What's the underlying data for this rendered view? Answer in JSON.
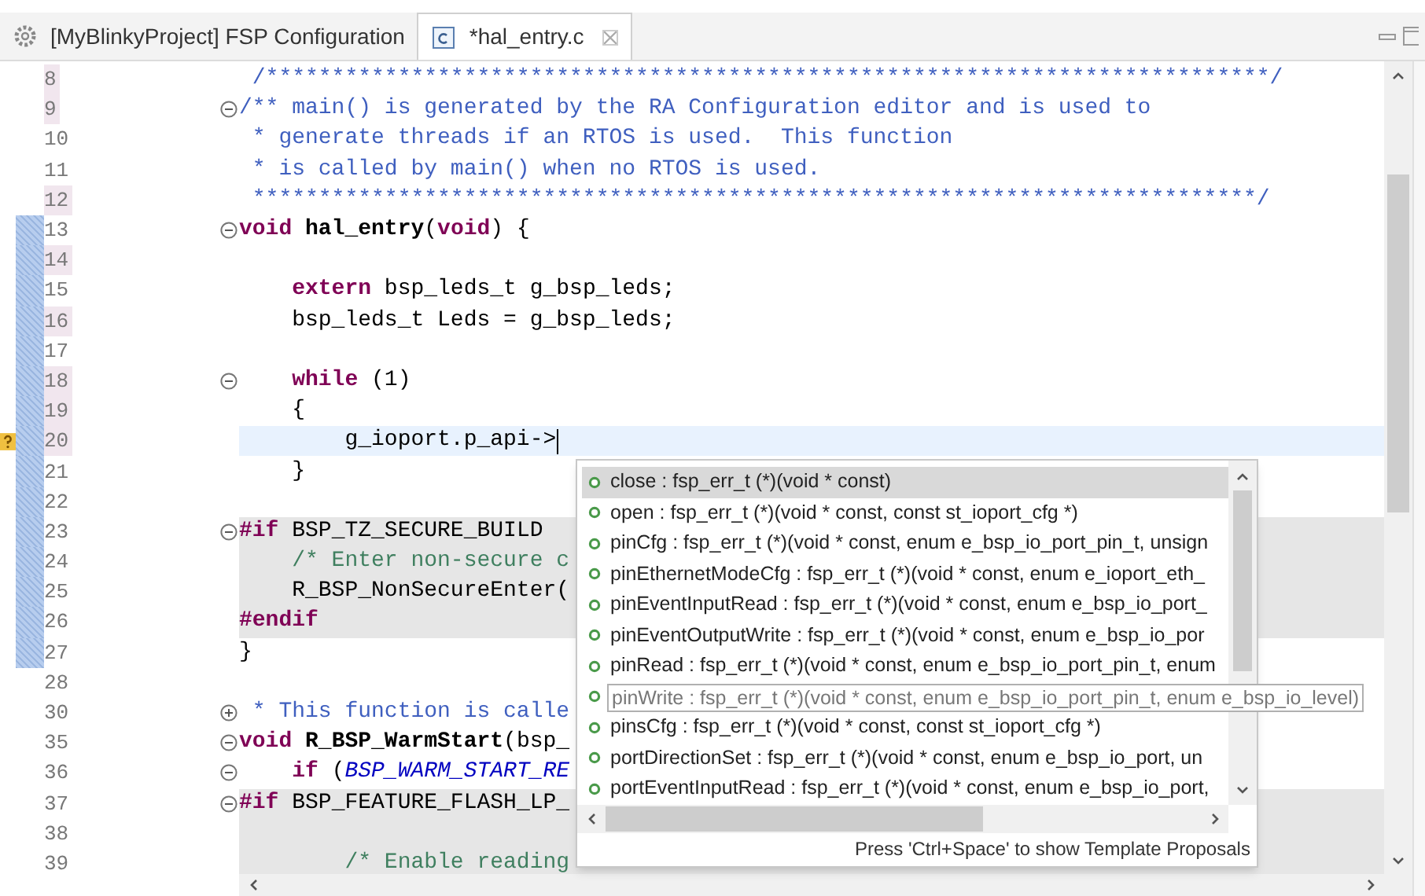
{
  "tabs": [
    {
      "label": "[MyBlinkyProject] FSP Configuration",
      "selected": false
    },
    {
      "label": "*hal_entry.c",
      "selected": true
    }
  ],
  "editor": {
    "lines": [
      {
        "number": "8",
        "highlight": true,
        "tokens": [
          {
            "kind": "doc",
            "text": " /****************************************************************************/"
          }
        ]
      },
      {
        "number": "9",
        "highlight": true,
        "foldable": true,
        "collapsed": false,
        "tokens": [
          {
            "kind": "doc",
            "text": "/** main() is generated by the RA Configuration editor and is used to"
          }
        ]
      },
      {
        "number": "10",
        "highlight": false,
        "tokens": [
          {
            "kind": "doc",
            "text": " * generate threads if an RTOS is used.  This function"
          }
        ]
      },
      {
        "number": "11",
        "highlight": false,
        "tokens": [
          {
            "kind": "doc",
            "text": " * is called by main() when no RTOS is used."
          }
        ]
      },
      {
        "number": "12",
        "highlight": true,
        "tokens": [
          {
            "kind": "doc",
            "text": " ****************************************************************************/"
          }
        ]
      },
      {
        "number": "13",
        "changed": true,
        "highlight": false,
        "foldable": true,
        "collapsed": false,
        "tokens": [
          {
            "kind": "keyword",
            "text": "void "
          },
          {
            "kind": "bold",
            "text": "hal_entry"
          },
          {
            "kind": "plain",
            "text": "("
          },
          {
            "kind": "keyword",
            "text": "void"
          },
          {
            "kind": "plain",
            "text": ") {"
          }
        ]
      },
      {
        "number": "14",
        "changed": true,
        "highlight": true
      },
      {
        "number": "15",
        "changed": true,
        "highlight": false,
        "tokens": [
          {
            "kind": "keyword",
            "text": "    extern"
          },
          {
            "kind": "plain",
            "text": " bsp_leds_t g_bsp_leds;"
          }
        ]
      },
      {
        "number": "16",
        "changed": true,
        "highlight": true,
        "tokens": [
          {
            "kind": "plain",
            "text": "    bsp_leds_t Leds = g_bsp_leds;"
          }
        ]
      },
      {
        "number": "17",
        "changed": true,
        "highlight": false
      },
      {
        "number": "18",
        "changed": true,
        "highlight": true,
        "foldable": true,
        "collapsed": false,
        "tokens": [
          {
            "kind": "keyword",
            "text": "    while"
          },
          {
            "kind": "plain",
            "text": " (1)"
          }
        ]
      },
      {
        "number": "19",
        "changed": true,
        "highlight": true,
        "tokens": [
          {
            "kind": "plain",
            "text": "    {"
          }
        ]
      },
      {
        "number": "20",
        "changed": true,
        "highlight": true,
        "warning": true,
        "current": true,
        "tokens": [
          {
            "kind": "plain",
            "text": "        g_ioport.p_api->"
          }
        ]
      },
      {
        "number": "21",
        "changed": true,
        "highlight": false,
        "tokens": [
          {
            "kind": "plain",
            "text": "    }"
          }
        ]
      },
      {
        "number": "22",
        "changed": true,
        "highlight": false
      },
      {
        "number": "23",
        "changed": true,
        "highlight": false,
        "block": true,
        "foldable": true,
        "collapsed": false,
        "tokens": [
          {
            "kind": "keyword",
            "text": "#if"
          },
          {
            "kind": "plain",
            "text": " BSP_TZ_SECURE_BUILD"
          }
        ]
      },
      {
        "number": "24",
        "changed": true,
        "highlight": false,
        "block": true,
        "tokens": [
          {
            "kind": "comment",
            "text": "    /* Enter non-secure c"
          }
        ]
      },
      {
        "number": "25",
        "changed": true,
        "highlight": false,
        "block": true,
        "tokens": [
          {
            "kind": "plain",
            "text": "    R_BSP_NonSecureEnter("
          }
        ]
      },
      {
        "number": "26",
        "changed": true,
        "highlight": false,
        "block": true,
        "tokens": [
          {
            "kind": "keyword",
            "text": "#endif"
          }
        ]
      },
      {
        "number": "27",
        "changed": true,
        "highlight": false,
        "tokens": [
          {
            "kind": "plain",
            "text": "}"
          }
        ]
      },
      {
        "number": "28",
        "highlight": false
      },
      {
        "number": "30",
        "highlight": false,
        "foldable": true,
        "collapsed": true,
        "tokens": [
          {
            "kind": "doc",
            "text": " * This function is calle"
          }
        ]
      },
      {
        "number": "35",
        "highlight": false,
        "foldable": true,
        "collapsed": false,
        "tokens": [
          {
            "kind": "keyword",
            "text": "void "
          },
          {
            "kind": "bold",
            "text": "R_BSP_WarmStart"
          },
          {
            "kind": "plain",
            "text": "(bsp_"
          }
        ]
      },
      {
        "number": "36",
        "highlight": false,
        "foldable": true,
        "collapsed": false,
        "tokens": [
          {
            "kind": "keyword",
            "text": "    if"
          },
          {
            "kind": "plain",
            "text": " ("
          },
          {
            "kind": "macro",
            "text": "BSP_WARM_START_RE"
          }
        ]
      },
      {
        "number": "37",
        "highlight": false,
        "block": true,
        "foldable": true,
        "collapsed": false,
        "tokens": [
          {
            "kind": "keyword",
            "text": "#if"
          },
          {
            "kind": "plain",
            "text": " BSP_FEATURE_FLASH_LP_"
          }
        ]
      },
      {
        "number": "38",
        "highlight": false,
        "block": true
      },
      {
        "number": "39",
        "highlight": false,
        "block": true,
        "tokens": [
          {
            "kind": "comment",
            "text": "        /* Enable reading"
          }
        ]
      }
    ]
  },
  "completion": {
    "proposals": [
      {
        "label": "close : fsp_err_t (*)(void * const)",
        "selected": true
      },
      {
        "label": "open : fsp_err_t (*)(void * const, const st_ioport_cfg *)",
        "selected": false
      },
      {
        "label": "pinCfg : fsp_err_t (*)(void * const, enum e_bsp_io_port_pin_t, unsign",
        "selected": false
      },
      {
        "label": "pinEthernetModeCfg : fsp_err_t (*)(void * const, enum e_ioport_eth_",
        "selected": false
      },
      {
        "label": "pinEventInputRead : fsp_err_t (*)(void * const, enum e_bsp_io_port_",
        "selected": false
      },
      {
        "label": "pinEventOutputWrite : fsp_err_t (*)(void * const, enum e_bsp_io_por",
        "selected": false
      },
      {
        "label": "pinRead : fsp_err_t (*)(void * const, enum e_bsp_io_port_pin_t, enum",
        "selected": false
      },
      {
        "label": "pinWrite : fsp_err_t (*)(void * const, enum e_bsp_io_port_pin_t, enum e_bsp_io_level)",
        "selected": false,
        "hovered": true
      },
      {
        "label": "pinsCfg : fsp_err_t (*)(void * const, const st_ioport_cfg *)",
        "selected": false
      },
      {
        "label": "portDirectionSet : fsp_err_t (*)(void * const, enum e_bsp_io_port, un",
        "selected": false
      },
      {
        "label": "portEventInputRead : fsp_err_t (*)(void * const, enum e_bsp_io_port,",
        "selected": false
      }
    ],
    "footer": "Press 'Ctrl+Space' to show Template Proposals"
  }
}
